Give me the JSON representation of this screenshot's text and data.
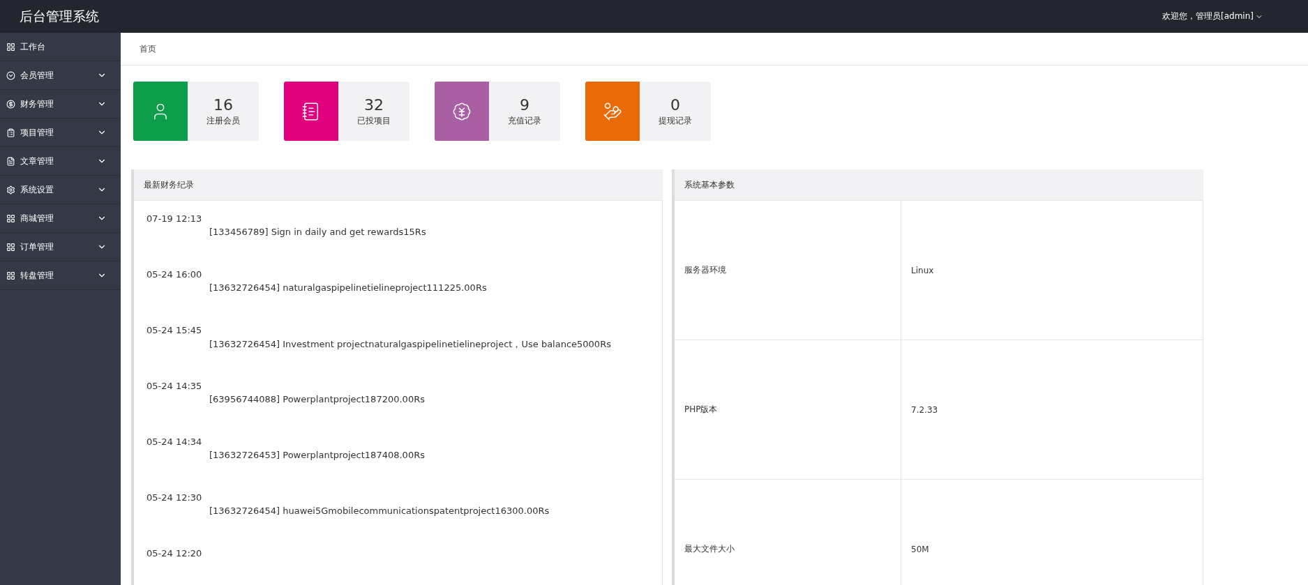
{
  "header": {
    "title": "后台管理系统",
    "user_menu": "欢迎您，管理员[admin]"
  },
  "sidebar": {
    "items": [
      {
        "label": "工作台",
        "kind": "link"
      },
      {
        "label": "会员管理",
        "kind": "group"
      },
      {
        "label": "财务管理",
        "kind": "group"
      },
      {
        "label": "项目管理",
        "kind": "group"
      },
      {
        "label": "文章管理",
        "kind": "group"
      },
      {
        "label": "系统设置",
        "kind": "group"
      },
      {
        "label": "商城管理",
        "kind": "group"
      },
      {
        "label": "订单管理",
        "kind": "group"
      },
      {
        "label": "转盘管理",
        "kind": "group"
      }
    ]
  },
  "breadcrumb": "首页",
  "stats": [
    {
      "value": "16",
      "label": "注册会员",
      "color": "#0c9e4b"
    },
    {
      "value": "32",
      "label": "已投项目",
      "color": "#e3007e"
    },
    {
      "value": "9",
      "label": "充值记录",
      "color": "#a95fa3"
    },
    {
      "value": "0",
      "label": "提现记录",
      "color": "#eb6a08"
    }
  ],
  "finance_panel": {
    "title": "最新财务纪录",
    "records": [
      {
        "time": "07-19 12:13",
        "text": "[133456789] Sign in daily and get rewards15Rs"
      },
      {
        "time": "05-24 16:00",
        "text": "[13632726454] naturalgaspipelinetielineproject111225.00Rs"
      },
      {
        "time": "05-24 15:45",
        "text": "[13632726454] Investment projectnaturalgaspipelinetielineproject，Use balance5000Rs"
      },
      {
        "time": "05-24 14:35",
        "text": "[63956744088] Powerplantproject187200.00Rs"
      },
      {
        "time": "05-24 14:34",
        "text": "[13632726453] Powerplantproject187408.00Rs"
      },
      {
        "time": "05-24 12:30",
        "text": "[13632726454] huawei5Gmobilecommunicationspatentproject16300.00Rs"
      },
      {
        "time": "05-24 12:20"
      }
    ]
  },
  "params_panel": {
    "title": "系统基本参数",
    "rows": [
      {
        "name": "服务器环境",
        "value": "Linux"
      },
      {
        "name": "PHP版本",
        "value": "7.2.33"
      },
      {
        "name": "最大文件大小",
        "value": "50M"
      }
    ]
  }
}
